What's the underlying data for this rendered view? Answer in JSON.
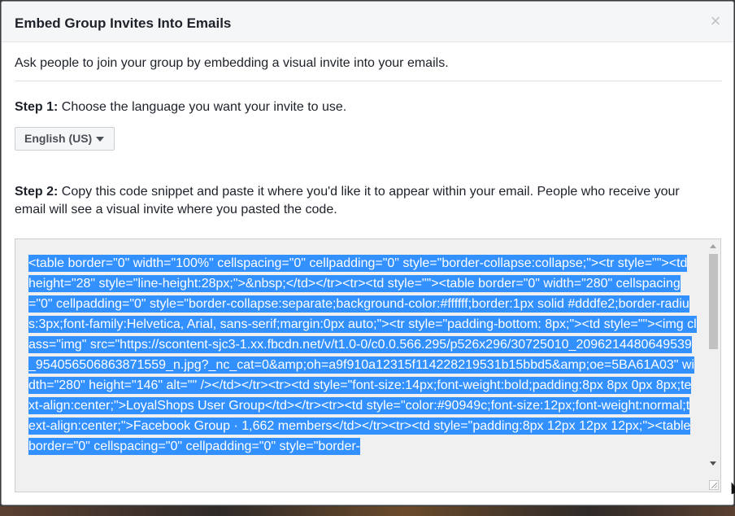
{
  "dialog": {
    "title": "Embed Group Invites Into Emails",
    "close_icon": "×",
    "intro": "Ask people to join your group by embedding a visual invite into your emails.",
    "step1": {
      "label": "Step 1:",
      "text": " Choose the language you want your invite to use."
    },
    "language_select": {
      "value": "English (US)",
      "icon": "caret-down-icon"
    },
    "step2": {
      "label": "Step 2:",
      "text": " Copy this code snippet and paste it where you'd like it to appear within your email. People who receive your email will see a visual invite where you pasted the code."
    },
    "code_snippet": "<table border=\"0\" width=\"100%\" cellspacing=\"0\" cellpadding=\"0\" style=\"border-collapse:collapse;\"><tr style=\"\"><td height=\"28\" style=\"line-height:28px;\">&nbsp;</td></tr><tr><td style=\"\"><table border=\"0\" width=\"280\" cellspacing=\"0\" cellpadding=\"0\" style=\"border-collapse:separate;background-color:#ffffff;border:1px solid #dddfe2;border-radius:3px;font-family:Helvetica, Arial, sans-serif;margin:0px auto;\"><tr style=\"padding-bottom: 8px;\"><td style=\"\"><img class=\"img\" src=\"https://scontent-sjc3-1.xx.fbcdn.net/v/t1.0-0/c0.0.566.295/p526x296/30725010_2096214480649539_954056506863871559_n.jpg?_nc_cat=0&amp;oh=a9f910a12315f114228219531b15bbd5&amp;oe=5BA61A03\" width=\"280\" height=\"146\" alt=\"\" /></td></tr><tr><td style=\"font-size:14px;font-weight:bold;padding:8px 8px 0px 8px;text-align:center;\">LoyalShops User Group</td></tr><tr><td style=\"color:#90949c;font-size:12px;font-weight:normal;text-align:center;\">Facebook Group · 1,662 members</td></tr><tr><td style=\"padding:8px 12px 12px 12px;\"><table border=\"0\" cellspacing=\"0\" cellpadding=\"0\" style=\"border-",
    "selection_color": "#3390ff"
  }
}
